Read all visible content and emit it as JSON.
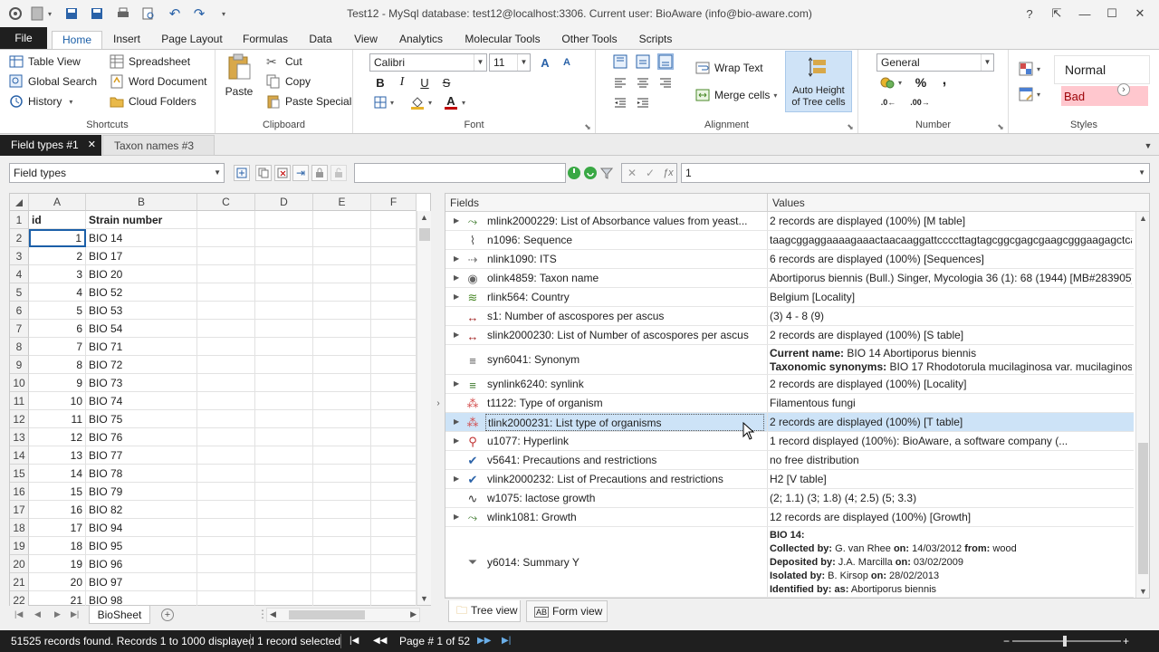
{
  "window": {
    "title": "Test12 - MySql database: test12@localhost:3306. Current user: BioAware (info@bio-aware.com)",
    "controls": [
      "?",
      "⇱",
      "—",
      "☐",
      "✕"
    ]
  },
  "ribbon_tabs": [
    "File",
    "Home",
    "Insert",
    "Page Layout",
    "Formulas",
    "Data",
    "View",
    "Analytics",
    "Molecular Tools",
    "Other Tools",
    "Scripts"
  ],
  "active_ribbon_tab": "Home",
  "shortcuts": {
    "label": "Shortcuts",
    "items": [
      "Table View",
      "Global Search",
      "History",
      "Spreadsheet",
      "Word Document",
      "Cloud Folders"
    ]
  },
  "clipboard": {
    "label": "Clipboard",
    "paste": "Paste",
    "cut": "Cut",
    "copy": "Copy",
    "paste_special": "Paste Special"
  },
  "font": {
    "label": "Font",
    "family": "Calibri",
    "size": "11",
    "bold": "B",
    "italic": "I",
    "underline": "U",
    "strike": "S"
  },
  "alignment": {
    "label": "Alignment",
    "wrap_text": "Wrap Text",
    "merge_cells": "Merge cells",
    "auto_height_1": "Auto Height",
    "auto_height_2": "of Tree cells"
  },
  "number": {
    "label": "Number",
    "format": "General",
    "percent": "%",
    "comma": ","
  },
  "styles": {
    "label": "Styles",
    "normal": "Normal",
    "bad": "Bad"
  },
  "doc_tabs": [
    {
      "label": "Field types #1",
      "close": "✕"
    },
    {
      "label": "Taxon names #3"
    }
  ],
  "toolbar": {
    "table_selector": "Field types",
    "search_value": "",
    "formula_value": "1"
  },
  "sheet": {
    "columns": [
      "A",
      "B",
      "C",
      "D",
      "E",
      "F"
    ],
    "rows": [
      {
        "n": "1",
        "a": "id",
        "b": "Strain number"
      },
      {
        "n": "2",
        "a": "1",
        "b": "BIO 14"
      },
      {
        "n": "3",
        "a": "2",
        "b": "BIO 17"
      },
      {
        "n": "4",
        "a": "3",
        "b": "BIO 20"
      },
      {
        "n": "5",
        "a": "4",
        "b": "BIO 52"
      },
      {
        "n": "6",
        "a": "5",
        "b": "BIO 53"
      },
      {
        "n": "7",
        "a": "6",
        "b": "BIO 54"
      },
      {
        "n": "8",
        "a": "7",
        "b": "BIO 71"
      },
      {
        "n": "9",
        "a": "8",
        "b": "BIO 72"
      },
      {
        "n": "10",
        "a": "9",
        "b": "BIO 73"
      },
      {
        "n": "11",
        "a": "10",
        "b": "BIO 74"
      },
      {
        "n": "12",
        "a": "11",
        "b": "BIO 75"
      },
      {
        "n": "13",
        "a": "12",
        "b": "BIO 76"
      },
      {
        "n": "14",
        "a": "13",
        "b": "BIO 77"
      },
      {
        "n": "15",
        "a": "14",
        "b": "BIO 78"
      },
      {
        "n": "16",
        "a": "15",
        "b": "BIO 79"
      },
      {
        "n": "17",
        "a": "16",
        "b": "BIO 82"
      },
      {
        "n": "18",
        "a": "17",
        "b": "BIO 94"
      },
      {
        "n": "19",
        "a": "18",
        "b": "BIO 95"
      },
      {
        "n": "20",
        "a": "19",
        "b": "BIO 96"
      },
      {
        "n": "21",
        "a": "20",
        "b": "BIO 97"
      },
      {
        "n": "22",
        "a": "21",
        "b": "BIO 98"
      }
    ],
    "sheet_tab": "BioSheet"
  },
  "tree": {
    "col_fields": "Fields",
    "col_values": "Values",
    "rows": [
      {
        "field": "mlink2000229: List of Absorbance values from yeast...",
        "value": "2 records are displayed (100%) [M table]",
        "expand": true
      },
      {
        "field": "n1096: Sequence",
        "value": "taagcggaggaaaagaaactaacaaggattccccttagtagcggcgagcgaagcgggaagagctca...",
        "expand": false
      },
      {
        "field": "nlink1090: ITS",
        "value": "6 records are displayed (100%) [Sequences]",
        "expand": true
      },
      {
        "field": "olink4859: Taxon name",
        "value": "Abortiporus biennis (Bull.) Singer, Mycologia 36 (1): 68 (1944) [MB#283905]...",
        "expand": true
      },
      {
        "field": "rlink564: Country",
        "value": "Belgium [Locality]",
        "expand": true
      },
      {
        "field": "s1: Number of ascospores per ascus",
        "value": "(3) 4 - 8 (9)",
        "expand": false
      },
      {
        "field": "slink2000230: List of Number of ascospores per ascus",
        "value": "2 records are displayed (100%) [S table]",
        "expand": true
      },
      {
        "field": "syn6041: Synonym",
        "expand": false,
        "l1": "Current name:",
        "v1": " BIO 14 Abortiporus biennis",
        "l2": "Taxonomic synonyms:",
        "v2": " BIO 17 Rhodotorula mucilaginosa var. mucilaginosa"
      },
      {
        "field": "synlink6240: synlink",
        "value": "2 records are displayed (100%) [Locality]",
        "expand": true
      },
      {
        "field": "t1122: Type of organism",
        "value": "Filamentous fungi",
        "expand": false
      },
      {
        "field": "tlink2000231: List type of organisms",
        "value": "2 records are displayed (100%) [T table]",
        "expand": true
      },
      {
        "field": "u1077: Hyperlink",
        "value": "1 record displayed (100%): BioAware, a software company (...",
        "expand": true
      },
      {
        "field": "v5641: Precautions and restrictions",
        "value": "no free distribution",
        "expand": false
      },
      {
        "field": "vlink2000232: List of Precautions and restrictions",
        "value": "H2 [V table]",
        "expand": true
      },
      {
        "field": "w1075: lactose growth",
        "value": "(2; 1.1) (3; 1.8) (4; 2.5) (5; 3.3)",
        "expand": false
      },
      {
        "field": "wlink1081: Growth",
        "value": "12 records are displayed (100%) [Growth]",
        "expand": true
      },
      {
        "field": "y6014: Summary Y",
        "expand": false,
        "head": "BIO 14:",
        "s1a": "Collected by:",
        "s1b": " G. van Rhee ",
        "s1c": "on:",
        "s1d": " 14/03/2012 ",
        "s1e": "from:",
        "s1f": " wood",
        "s2a": "Deposited by:",
        "s2b": " J.A. Marcilla ",
        "s2c": "on:",
        "s2d": " 03/02/2009",
        "s3a": "Isolated by:",
        "s3b": " B. Kirsop ",
        "s3c": "on:",
        "s3d": " 28/02/2013",
        "s4a": "Identified by:",
        "s4b": " ",
        "s4c": "as:",
        "s4d": " Abortiporus biennis"
      }
    ]
  },
  "view_tabs": [
    "Tree view",
    "Form view"
  ],
  "status": {
    "records": "51525 records found. Records 1 to 1000 displayed",
    "selected": "1 record selected",
    "page": "Page # 1 of 52"
  },
  "colors": {
    "accent": "#1b5fa8",
    "selection": "#cde3f7",
    "status_bg": "#1f1f1f",
    "bad_bg": "#ffc7ce",
    "bad_fg": "#9c0006"
  }
}
